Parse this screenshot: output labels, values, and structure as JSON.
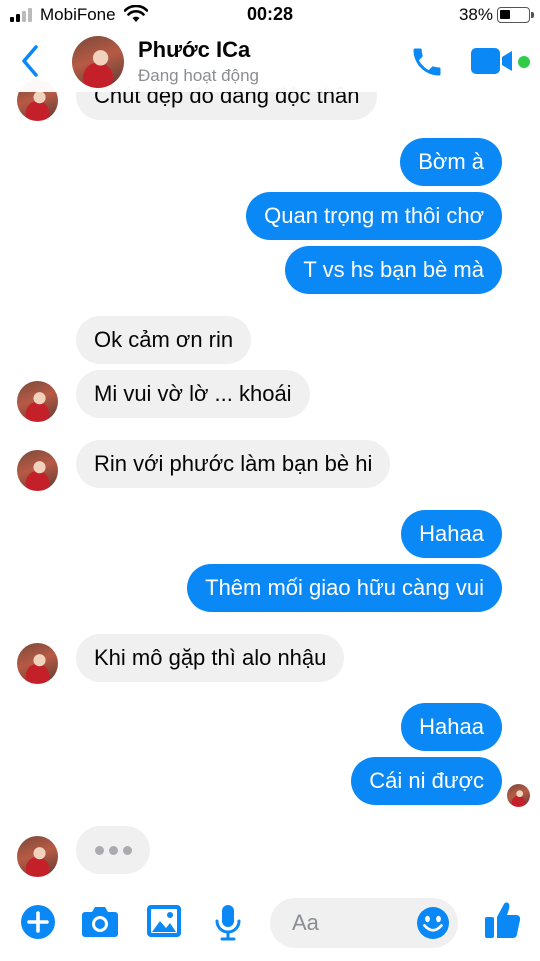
{
  "status_bar": {
    "carrier": "MobiFone",
    "time": "00:28",
    "battery": "38%"
  },
  "header": {
    "name": "Phước ICa",
    "status": "Đang hoạt động"
  },
  "messages": [
    {
      "from": "them",
      "text": "Chút đẹp đổ dáng độc thân"
    },
    {
      "from": "me",
      "text": "Bờm à"
    },
    {
      "from": "me",
      "text": "Quan trọng m thôi chơ"
    },
    {
      "from": "me",
      "text": "T vs hs bạn bè mà"
    },
    {
      "from": "them",
      "text": "Ok cảm ơn rin"
    },
    {
      "from": "them",
      "text": "Mi vui vờ lờ ... khoái"
    },
    {
      "from": "them",
      "text": "Rin với phước làm bạn bè hi"
    },
    {
      "from": "me",
      "text": "Hahaa"
    },
    {
      "from": "me",
      "text": "Thêm mối giao hữu càng vui"
    },
    {
      "from": "them",
      "text": "Khi mô gặp thì alo nhậu"
    },
    {
      "from": "me",
      "text": "Hahaa"
    },
    {
      "from": "me",
      "text": "Cái ni được"
    }
  ],
  "composer": {
    "placeholder": "Aa"
  },
  "colors": {
    "accent": "#0a88f5",
    "incoming_bubble": "#f0f0f0",
    "online": "#31cc46"
  }
}
